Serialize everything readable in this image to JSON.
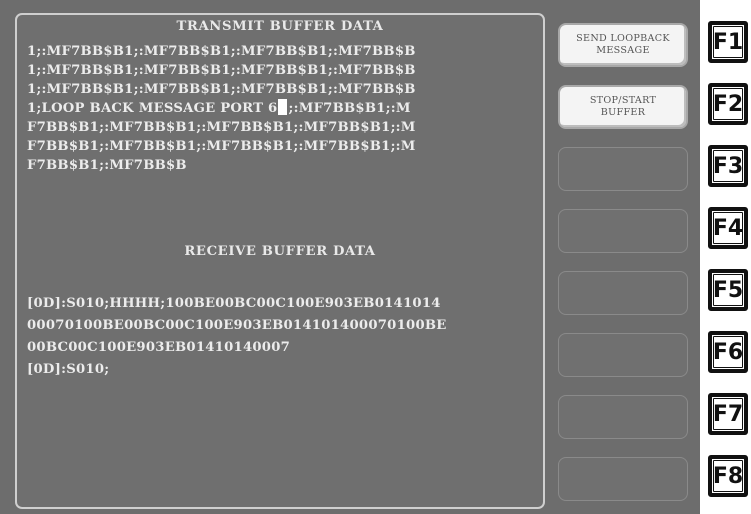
{
  "transmit_buffer": {
    "title": "TRANSMIT BUFFER DATA",
    "lines": [
      "1;:MF7BB$B1;:MF7BB$B1;:MF7BB$B1;:MF7BB$B",
      "1;:MF7BB$B1;:MF7BB$B1;:MF7BB$B1;:MF7BB$B",
      "1;:MF7BB$B1;:MF7BB$B1;:MF7BB$B1;:MF7BB$B",
      "F7BB$B1;:MF7BB$B1;:MF7BB$B1;:MF7BB$B1;:M",
      "F7BB$B1;:MF7BB$B1;:MF7BB$B1;:MF7BB$B1;:M",
      "F7BB$B1;:MF7BB$B"
    ],
    "cursor_line_before": "1;LOOP BACK MESSAGE PORT 6",
    "cursor_line_after": ";:MF7BB$B1;:M"
  },
  "receive_buffer": {
    "title": "RECEIVE BUFFER DATA",
    "lines": [
      "[0D]:S010;HHHH;100BE00BC00C100E903EB0141014",
      "00070100BE00BC00C100E903EB014101400070100BE",
      "00BC00C100E903EB01410140007",
      "[0D]:S010;"
    ]
  },
  "softkeys": [
    {
      "line1": "SEND LOOPBACK",
      "line2": "MESSAGE"
    },
    {
      "line1": "STOP/START",
      "line2": "BUFFER"
    },
    {
      "line1": "",
      "line2": ""
    },
    {
      "line1": "",
      "line2": ""
    },
    {
      "line1": "",
      "line2": ""
    },
    {
      "line1": "",
      "line2": ""
    },
    {
      "line1": "",
      "line2": ""
    },
    {
      "line1": "",
      "line2": ""
    }
  ],
  "function_keys": [
    "F1",
    "F2",
    "F3",
    "F4",
    "F5",
    "F6",
    "F7",
    "F8"
  ],
  "colors": {
    "screen_background": "#6d6d6d",
    "text": "#ececec",
    "softkey_active": "#f4f4f4",
    "function_key_border": "#111111"
  }
}
